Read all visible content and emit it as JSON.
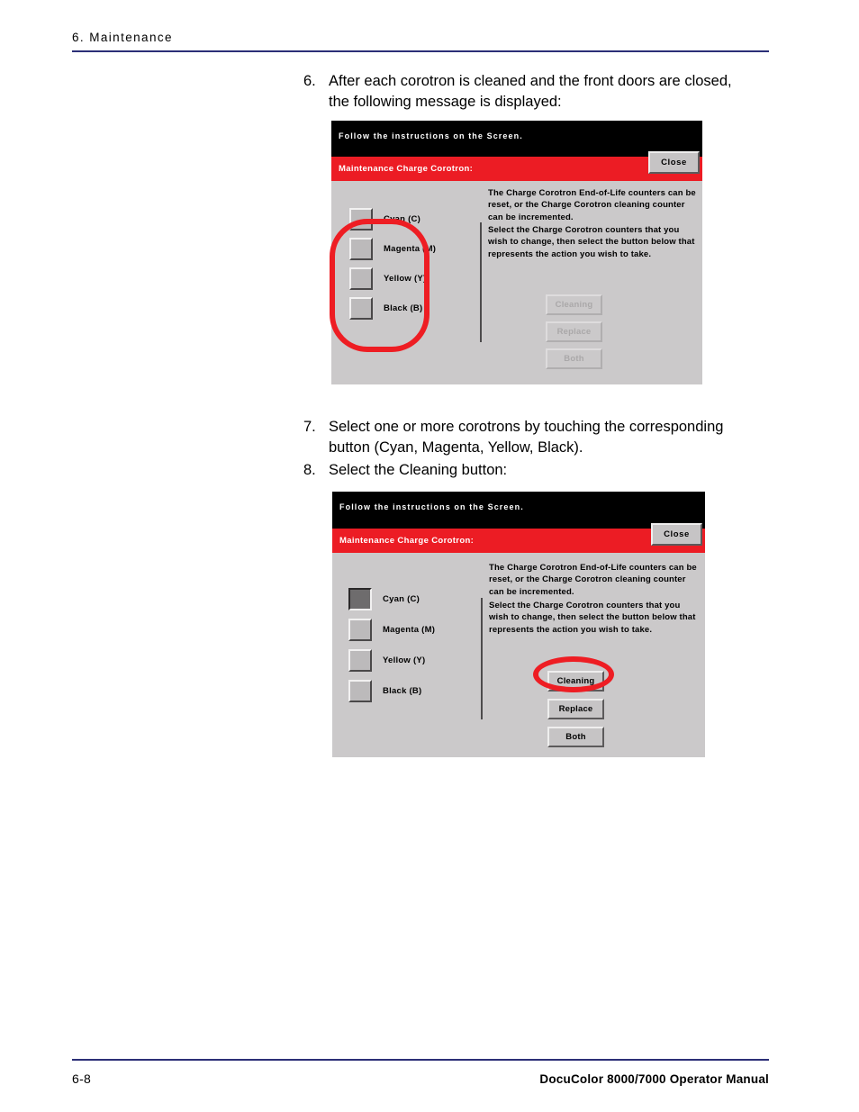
{
  "header": {
    "chapter": "6. Maintenance"
  },
  "footer": {
    "page_number": "6-8",
    "manual_title": "DocuColor 8000/7000 Operator Manual"
  },
  "steps": [
    {
      "number": "6.",
      "text": "After each corotron is cleaned and the front doors are closed, the following message is displayed:"
    },
    {
      "number": "7.",
      "text": "Select one or more corotrons by touching the corresponding button (Cyan, Magenta, Yellow, Black)."
    },
    {
      "number": "8.",
      "text": "Select the Cleaning button:"
    }
  ],
  "screens": [
    {
      "status_message": "Follow the instructions on the Screen.",
      "title": "Maintenance Charge Corotron:",
      "close_label": "Close",
      "info_paragraph_1": "The Charge Corotron End-of-Life counters can be reset, or the Charge Corotron cleaning counter can be incremented.",
      "info_paragraph_2": "Select the Charge Corotron counters that you wish to change, then select the button below that represents the action you wish to take.",
      "color_buttons": [
        {
          "label": "Cyan (C)",
          "selected": false
        },
        {
          "label": "Magenta (M)",
          "selected": false
        },
        {
          "label": "Yellow (Y)",
          "selected": false
        },
        {
          "label": "Black (B)",
          "selected": false
        }
      ],
      "action_buttons": [
        {
          "label": "Cleaning",
          "enabled": false
        },
        {
          "label": "Replace",
          "enabled": false
        },
        {
          "label": "Both",
          "enabled": false
        }
      ]
    },
    {
      "status_message": "Follow the instructions on the Screen.",
      "title": "Maintenance Charge Corotron:",
      "close_label": "Close",
      "info_paragraph_1": "The Charge Corotron End-of-Life counters can be reset, or the Charge Corotron cleaning counter can be incremented.",
      "info_paragraph_2": "Select the Charge Corotron counters that you wish to change, then select the button below that represents the action you wish to take.",
      "color_buttons": [
        {
          "label": "Cyan (C)",
          "selected": true
        },
        {
          "label": "Magenta (M)",
          "selected": false
        },
        {
          "label": "Yellow (Y)",
          "selected": false
        },
        {
          "label": "Black (B)",
          "selected": false
        }
      ],
      "action_buttons": [
        {
          "label": "Cleaning",
          "enabled": true
        },
        {
          "label": "Replace",
          "enabled": true
        },
        {
          "label": "Both",
          "enabled": true
        }
      ]
    }
  ],
  "annotations": {
    "color_group_highlight": "rounded-rect-callout",
    "cleaning_button_highlight": "oval-callout",
    "color": "#ee1d23"
  }
}
